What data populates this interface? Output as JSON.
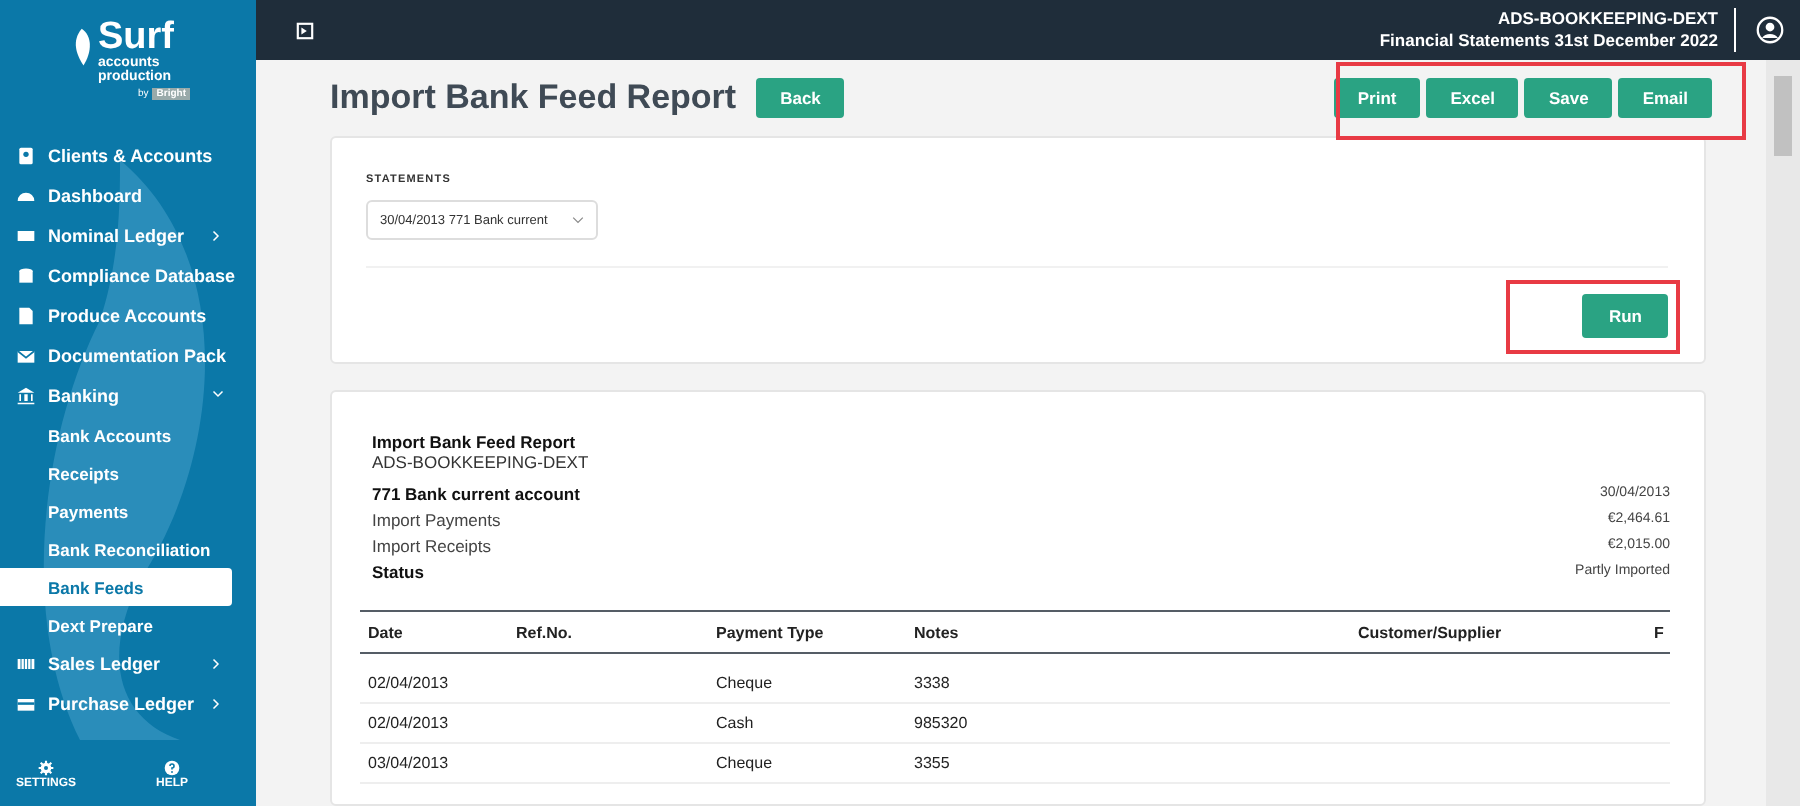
{
  "logo": {
    "name": "Surf",
    "tagline": "accounts production",
    "by": "by",
    "brand": "Bright"
  },
  "sidebar": {
    "items": [
      {
        "label": "Clients & Accounts",
        "kind": "link"
      },
      {
        "label": "Dashboard",
        "kind": "link"
      },
      {
        "label": "Nominal Ledger",
        "kind": "group",
        "expanded": false
      },
      {
        "label": "Compliance Database",
        "kind": "link"
      },
      {
        "label": "Produce Accounts",
        "kind": "link"
      },
      {
        "label": "Documentation Pack",
        "kind": "link"
      },
      {
        "label": "Banking",
        "kind": "group",
        "expanded": true,
        "children": [
          {
            "label": "Bank Accounts",
            "selected": false
          },
          {
            "label": "Receipts",
            "selected": false
          },
          {
            "label": "Payments",
            "selected": false
          },
          {
            "label": "Bank Reconciliation",
            "selected": false
          },
          {
            "label": "Bank Feeds",
            "selected": true
          },
          {
            "label": "Dext Prepare",
            "selected": false
          }
        ]
      },
      {
        "label": "Sales Ledger",
        "kind": "group",
        "expanded": false
      },
      {
        "label": "Purchase Ledger",
        "kind": "group",
        "expanded": false
      }
    ],
    "footer": [
      "SETTINGS",
      "HELP"
    ]
  },
  "header": {
    "company": "ADS-BOOKKEEPING-DEXT",
    "period": "Financial Statements 31st December 2022"
  },
  "page": {
    "title": "Import Bank Feed Report",
    "back": "Back",
    "actions": [
      "Print",
      "Excel",
      "Save",
      "Email"
    ]
  },
  "filters": {
    "label": "STATEMENTS",
    "statement": "30/04/2013 771 Bank current",
    "run": "Run"
  },
  "report": {
    "title": "Import Bank Feed Report",
    "company": "ADS-BOOKKEEPING-DEXT",
    "summary": [
      {
        "label": "771 Bank current account",
        "value": "30/04/2013",
        "bold": true
      },
      {
        "label": "Import Payments",
        "value": "€2,464.61",
        "bold": false
      },
      {
        "label": "Import Receipts",
        "value": "€2,015.00",
        "bold": false
      },
      {
        "label": "Status",
        "value": "Partly Imported",
        "bold": true
      }
    ],
    "table": {
      "columns": [
        "Date",
        "Ref.No.",
        "Payment Type",
        "Notes",
        "Customer/Supplier",
        "F"
      ],
      "rows": [
        [
          "02/04/2013",
          "",
          "Cheque",
          "3338",
          "",
          ""
        ],
        [
          "02/04/2013",
          "",
          "Cash",
          "985320",
          "",
          ""
        ],
        [
          "03/04/2013",
          "",
          "Cheque",
          "3355",
          "",
          ""
        ]
      ]
    }
  }
}
